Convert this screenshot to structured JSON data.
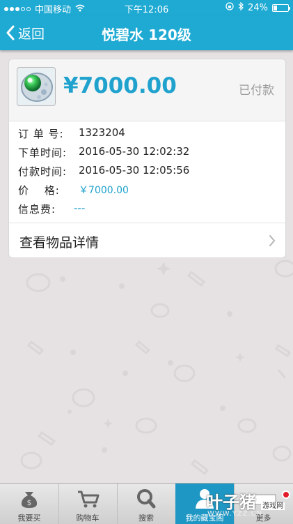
{
  "status_bar": {
    "carrier": "中国移动",
    "time": "下午12:06",
    "battery_percent": "24%",
    "battery_level": 0.24
  },
  "nav": {
    "back_label": "返回",
    "title": "悦碧水 120级"
  },
  "order": {
    "price": "¥7000.00",
    "status": "已付款",
    "fields": [
      {
        "label": "订 单 号:",
        "value": "1323204"
      },
      {
        "label": "下单时间:",
        "value": "2016-05-30 12:02:32"
      },
      {
        "label": "付款时间:",
        "value": "2016-05-30 12:05:56"
      },
      {
        "label": "价　 格:",
        "value": "￥7000.00"
      },
      {
        "label": "信息费:",
        "value": "---"
      }
    ],
    "detail_link": "查看物品详情"
  },
  "tabbar": {
    "tabs": [
      {
        "label": "我要买",
        "icon": "money-bag-icon"
      },
      {
        "label": "购物车",
        "icon": "cart-icon"
      },
      {
        "label": "搜索",
        "icon": "search-icon"
      },
      {
        "label": "我的藏宝阁",
        "icon": "user-icon"
      },
      {
        "label": "更多",
        "icon": "more-icon"
      }
    ],
    "active_index": 3
  },
  "watermark": {
    "brand": "叶子猪",
    "badge": "游戏网",
    "url": "WWW.YZZ.CN"
  },
  "colors": {
    "accent": "#1faad3",
    "price": "#1fa2cd",
    "badge_red": "#e21c2a"
  }
}
